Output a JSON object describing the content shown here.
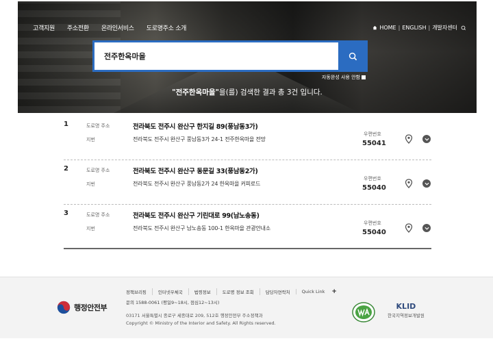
{
  "nav": [
    "고객지원",
    "주소전환",
    "온라인서비스",
    "도로명주소 소개"
  ],
  "toplinks": {
    "home": "HOME",
    "english": "ENGLISH",
    "dev": "개발자센터"
  },
  "search": {
    "value": "전주한옥마을"
  },
  "autocomplete_label": "자동완성 사용 안함",
  "summary": {
    "query": "\"전주한옥마을\"",
    "rest": "을(를) 검색한 결과 총 3건 입니다."
  },
  "labels": {
    "road": "도로명 주소",
    "jibun": "지번",
    "zip": "우편번호"
  },
  "results": [
    {
      "num": "1",
      "road": "전라북도 전주시 완산구 한지길 89(풍남동3가)",
      "jibun": "전라북도 전주시 완산구 풍남동3가 24-1 전주한옥마을 전망",
      "zip": "55041"
    },
    {
      "num": "2",
      "road": "전라북도 전주시 완산구 동문길 33(풍남동2가)",
      "jibun": "전라북도 전주시 완산구 풍남동2가 24 한옥마을 커피로드",
      "zip": "55040"
    },
    {
      "num": "3",
      "road": "전라북도 전주시 완산구 기린대로 99(남노송동)",
      "jibun": "전라북도 전주시 완산구 남노송동 100-1 한옥마을 관광안내소",
      "zip": "55040"
    }
  ],
  "footer": {
    "logo": "행정안전부",
    "links": [
      "정책브리핑",
      "인터넷우체국",
      "법령정보",
      "도로명 정보 조회",
      "담당자연락처",
      "Quick Link"
    ],
    "contact": "문의 1588-0061  (평일9~18시, 점심12~13시)",
    "address": "03171 서울특별시 종로구 세종대로 209, 512호 행정안전부 주소정책과",
    "copyright": "Copyright © Ministry of the Interior and Safety. All Rights reserved.",
    "klid_name": "KLID",
    "klid_title": "한국지역정보개발원"
  }
}
